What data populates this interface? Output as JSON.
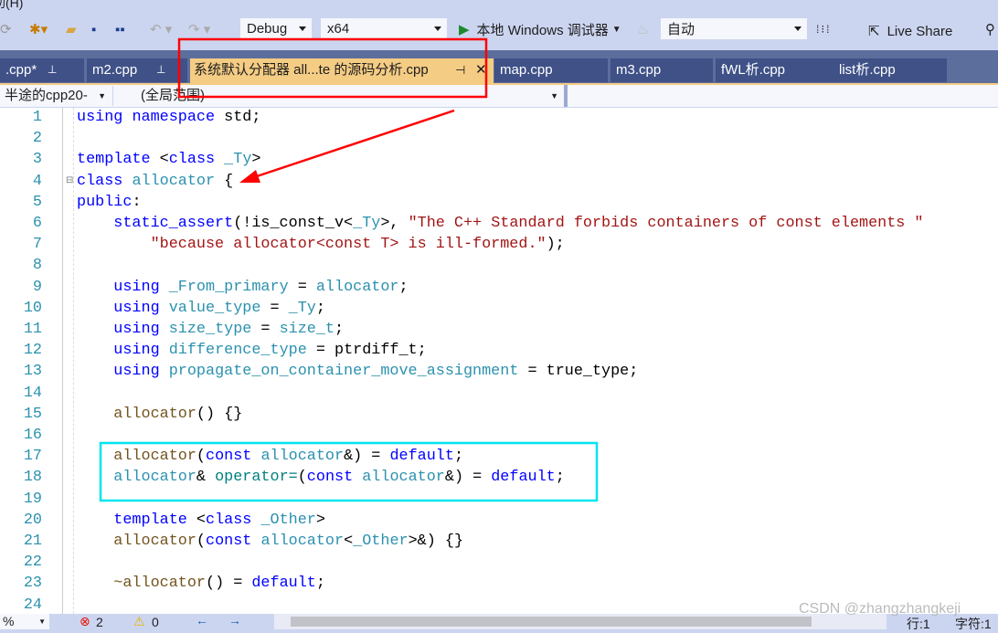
{
  "menu": {
    "partial_item": "助(H)"
  },
  "toolbar": {
    "config": "Debug",
    "platform": "x64",
    "run_label": "本地 Windows 调试器",
    "auto": "自动",
    "live_share": "Live Share"
  },
  "tabs": [
    {
      "label": ".cpp*",
      "pinned": true
    },
    {
      "label": "m2.cpp",
      "pinned": true
    },
    {
      "label": "系统默认分配器 all...te 的源码分析.cpp",
      "active": true
    },
    {
      "label": "map.cpp"
    },
    {
      "label": "m3.cpp"
    },
    {
      "label": "fWL析.cpp"
    },
    {
      "label": "list析.cpp"
    }
  ],
  "navbar": {
    "project": "半途的cpp20-",
    "scope": "(全局范围)"
  },
  "code": [
    [
      [
        "using",
        "kw"
      ],
      [
        " ",
        "pl"
      ],
      [
        "namespace",
        "kw"
      ],
      [
        " std;",
        "pl"
      ]
    ],
    [],
    [
      [
        "template",
        "kw"
      ],
      [
        " <",
        "pl"
      ],
      [
        "class",
        "kw"
      ],
      [
        " ",
        "pl"
      ],
      [
        "_Ty",
        "ty"
      ],
      [
        ">",
        "pl"
      ]
    ],
    [
      [
        "class",
        "kw"
      ],
      [
        " ",
        "pl"
      ],
      [
        "allocator",
        "ty"
      ],
      [
        " {",
        "pl"
      ]
    ],
    [
      [
        "public",
        "kw"
      ],
      [
        ":",
        "pl"
      ]
    ],
    [
      [
        "    static_assert",
        "kw"
      ],
      [
        "(!is_const_v<",
        "pl"
      ],
      [
        "_Ty",
        "ty"
      ],
      [
        ">, ",
        "pl"
      ],
      [
        "\"The C++ Standard forbids containers of const elements \"",
        "st"
      ]
    ],
    [
      [
        "        \"because allocator<const T> is ill-formed.\"",
        "st"
      ],
      [
        ");",
        "pl"
      ]
    ],
    [],
    [
      [
        "    using",
        "kw"
      ],
      [
        " ",
        "pl"
      ],
      [
        "_From_primary",
        "ty"
      ],
      [
        " = ",
        "pl"
      ],
      [
        "allocator",
        "ty"
      ],
      [
        ";",
        "pl"
      ]
    ],
    [
      [
        "    using",
        "kw"
      ],
      [
        " ",
        "pl"
      ],
      [
        "value_type",
        "ty"
      ],
      [
        " = ",
        "pl"
      ],
      [
        "_Ty",
        "ty"
      ],
      [
        ";",
        "pl"
      ]
    ],
    [
      [
        "    using",
        "kw"
      ],
      [
        " ",
        "pl"
      ],
      [
        "size_type",
        "ty"
      ],
      [
        " = ",
        "pl"
      ],
      [
        "size_t",
        "ty"
      ],
      [
        ";",
        "pl"
      ]
    ],
    [
      [
        "    using",
        "kw"
      ],
      [
        " ",
        "pl"
      ],
      [
        "difference_type",
        "ty"
      ],
      [
        " = ptrdiff_t;",
        "pl"
      ]
    ],
    [
      [
        "    using",
        "kw"
      ],
      [
        " ",
        "pl"
      ],
      [
        "propagate_on_container_move_assignment",
        "ty"
      ],
      [
        " = true_type;",
        "pl"
      ]
    ],
    [],
    [
      [
        "    allocator",
        "fn"
      ],
      [
        "() {}",
        "pl"
      ]
    ],
    [],
    [
      [
        "    allocator",
        "fn"
      ],
      [
        "(",
        "pl"
      ],
      [
        "const",
        "kw"
      ],
      [
        " ",
        "pl"
      ],
      [
        "allocator",
        "ty"
      ],
      [
        "&) = ",
        "pl"
      ],
      [
        "default",
        "kw"
      ],
      [
        ";",
        "pl"
      ]
    ],
    [
      [
        "    allocator",
        "ty"
      ],
      [
        "& ",
        "pl"
      ],
      [
        "operator=",
        "op"
      ],
      [
        "(",
        "pl"
      ],
      [
        "const",
        "kw"
      ],
      [
        " ",
        "pl"
      ],
      [
        "allocator",
        "ty"
      ],
      [
        "&) = ",
        "pl"
      ],
      [
        "default",
        "kw"
      ],
      [
        ";",
        "pl"
      ]
    ],
    [],
    [
      [
        "    template",
        "kw"
      ],
      [
        " <",
        "pl"
      ],
      [
        "class",
        "kw"
      ],
      [
        " ",
        "pl"
      ],
      [
        "_Other",
        "ty"
      ],
      [
        ">",
        "pl"
      ]
    ],
    [
      [
        "    allocator",
        "fn"
      ],
      [
        "(",
        "pl"
      ],
      [
        "const",
        "kw"
      ],
      [
        " ",
        "pl"
      ],
      [
        "allocator",
        "ty"
      ],
      [
        "<",
        "pl"
      ],
      [
        "_Other",
        "ty"
      ],
      [
        ">&) {}",
        "pl"
      ]
    ],
    [],
    [
      [
        "    ~allocator",
        "fn"
      ],
      [
        "() = ",
        "pl"
      ],
      [
        "default",
        "kw"
      ],
      [
        ";",
        "pl"
      ]
    ],
    []
  ],
  "status": {
    "zoom": "%",
    "errors": "2",
    "warnings": "0",
    "line": "行:1",
    "char": "字符:1",
    "watermark": "CSDN @zhangzhangkeji"
  },
  "colors": {
    "keyword": "#0000ff",
    "type": "#2b91af",
    "string": "#a31515",
    "function": "#74531f",
    "annotation_red": "#ff0000",
    "annotation_cyan": "#00e5ee"
  }
}
